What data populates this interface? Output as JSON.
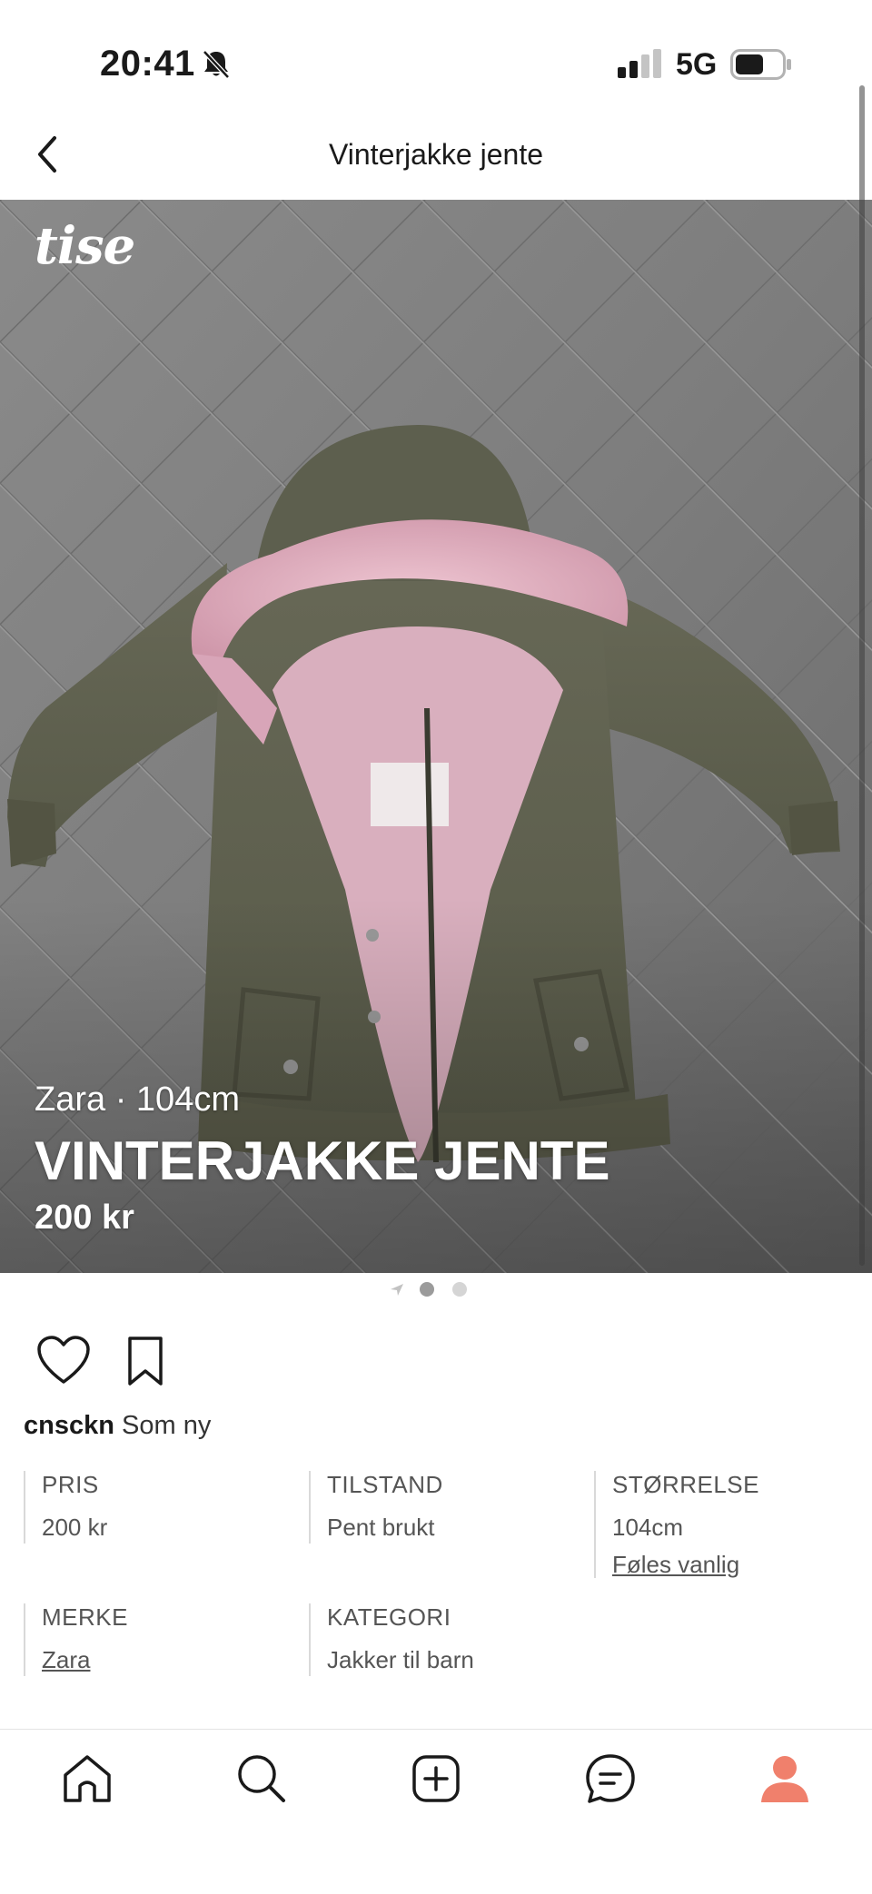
{
  "status_bar": {
    "time": "20:41",
    "network": "5G",
    "icons": [
      "bell-slash-icon",
      "signal-icon",
      "battery-icon"
    ]
  },
  "nav": {
    "title": "Vinterjakke jente",
    "back_icon": "chevron-left-icon"
  },
  "hero": {
    "logo": "tise",
    "brand": "Zara",
    "separator": "·",
    "size": "104cm",
    "title": "VINTERJAKKE JENTE",
    "price": "200 kr",
    "image_alt": "olive green winter jacket with pink fur hood on grey quilted blanket",
    "pager": {
      "total_dots": 2,
      "active_index": 0,
      "has_video_arrow": true
    }
  },
  "actions": {
    "like_icon": "heart-icon",
    "save_icon": "bookmark-icon"
  },
  "seller": {
    "username": "cnsckn",
    "condition_note": "Som ny"
  },
  "details": {
    "pris": {
      "label": "PRIS",
      "value": "200 kr"
    },
    "tilstand": {
      "label": "TILSTAND",
      "value": "Pent brukt"
    },
    "storrelse": {
      "label": "STØRRELSE",
      "value": "104cm",
      "fit_link": "Føles vanlig"
    },
    "merke": {
      "label": "MERKE",
      "value": "Zara"
    },
    "kategori": {
      "label": "KATEGORI",
      "value": "Jakker til barn"
    }
  },
  "tab_bar": {
    "tabs": [
      "home-icon",
      "search-icon",
      "add-icon",
      "messages-icon",
      "profile-icon"
    ],
    "active": "profile-icon"
  },
  "colors": {
    "accent": "#f0806c",
    "text": "#1a1a1a",
    "muted": "#555555",
    "jacket": "#5f604f",
    "fur": "#dcaabb"
  }
}
